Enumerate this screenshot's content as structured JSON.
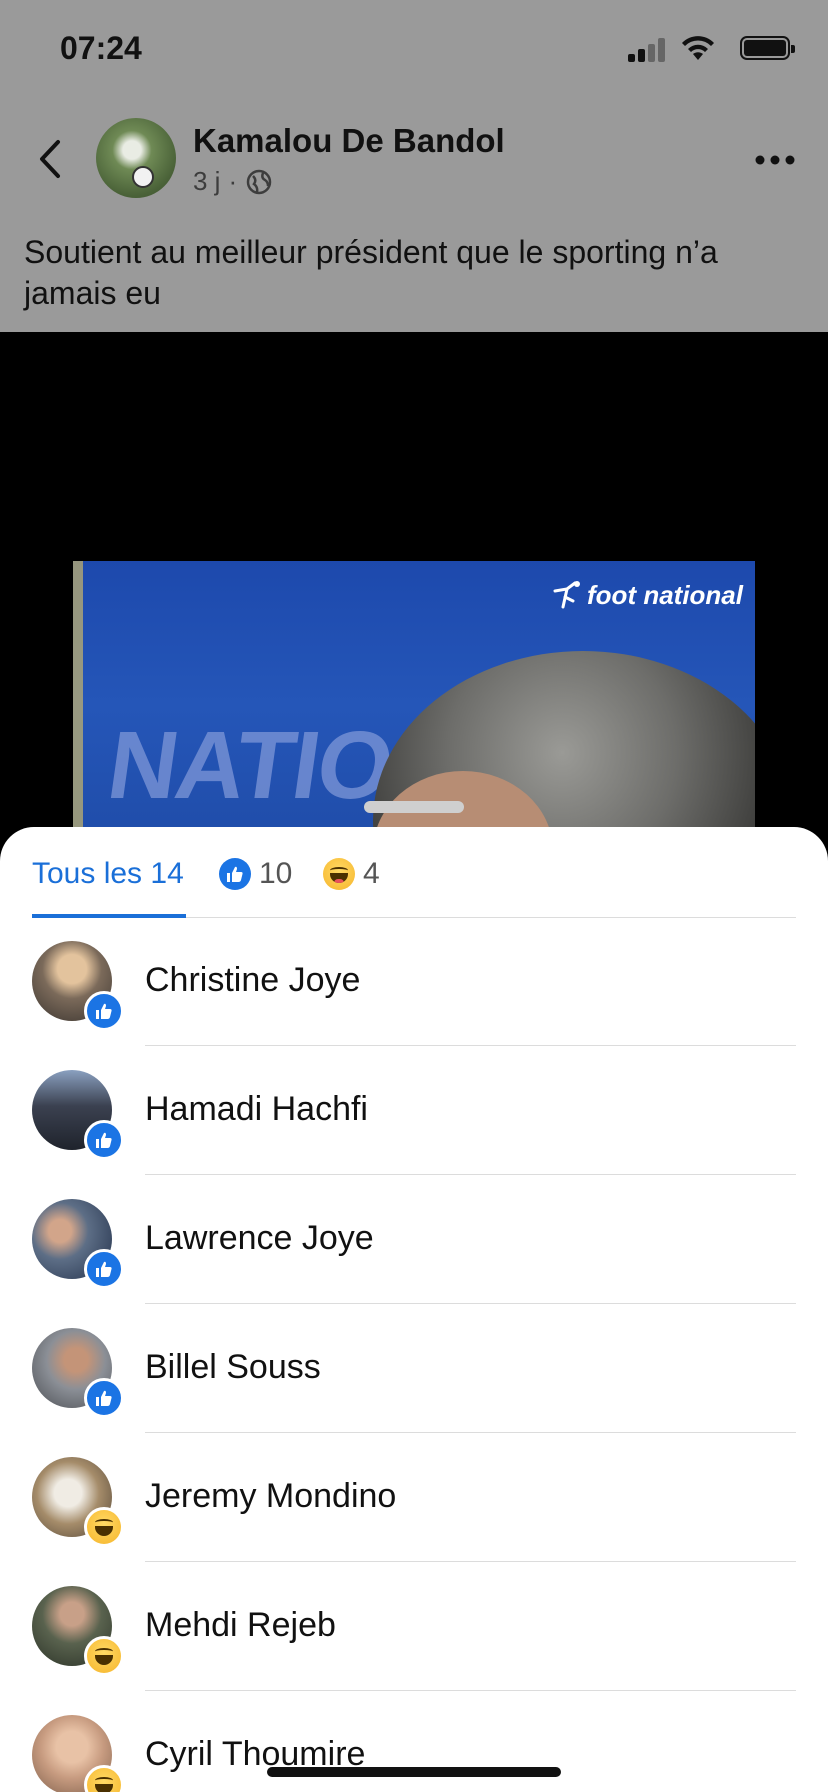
{
  "status_bar": {
    "time": "07:24"
  },
  "post": {
    "author_name": "Kamalou De Bandol",
    "time_ago": "3 j",
    "separator": "·",
    "privacy_icon": "globe-icon",
    "text": "Soutient au meilleur président que le sporting n’a jamais eu",
    "image": {
      "watermark": "foot national",
      "background_text": "NATIO"
    }
  },
  "reactions": {
    "tabs": [
      {
        "label": "Tous les 14",
        "active": true
      },
      {
        "icon": "like-icon",
        "count": "10"
      },
      {
        "icon": "haha-icon",
        "count": "4"
      }
    ],
    "people": [
      {
        "name": "Christine Joye",
        "reaction": "like",
        "avatar_color": "#7b6a5a"
      },
      {
        "name": "Hamadi Hachfi",
        "reaction": "like",
        "avatar_color": "#3b4150"
      },
      {
        "name": "Lawrence Joye",
        "reaction": "like",
        "avatar_color": "#5d6e86"
      },
      {
        "name": "Billel Souss",
        "reaction": "like",
        "avatar_color": "#8b8f96"
      },
      {
        "name": "Jeremy Mondino",
        "reaction": "haha",
        "avatar_color": "#a58c6a"
      },
      {
        "name": "Mehdi Rejeb",
        "reaction": "haha",
        "avatar_color": "#59624e"
      },
      {
        "name": "Cyril Thoumire",
        "reaction": "haha",
        "avatar_color": "#c79b80"
      }
    ]
  },
  "colors": {
    "accent": "#1a6fd8",
    "like": "#1b74e4",
    "haha": "#f6b52b",
    "dim_overlay": "#9a9a9a"
  }
}
